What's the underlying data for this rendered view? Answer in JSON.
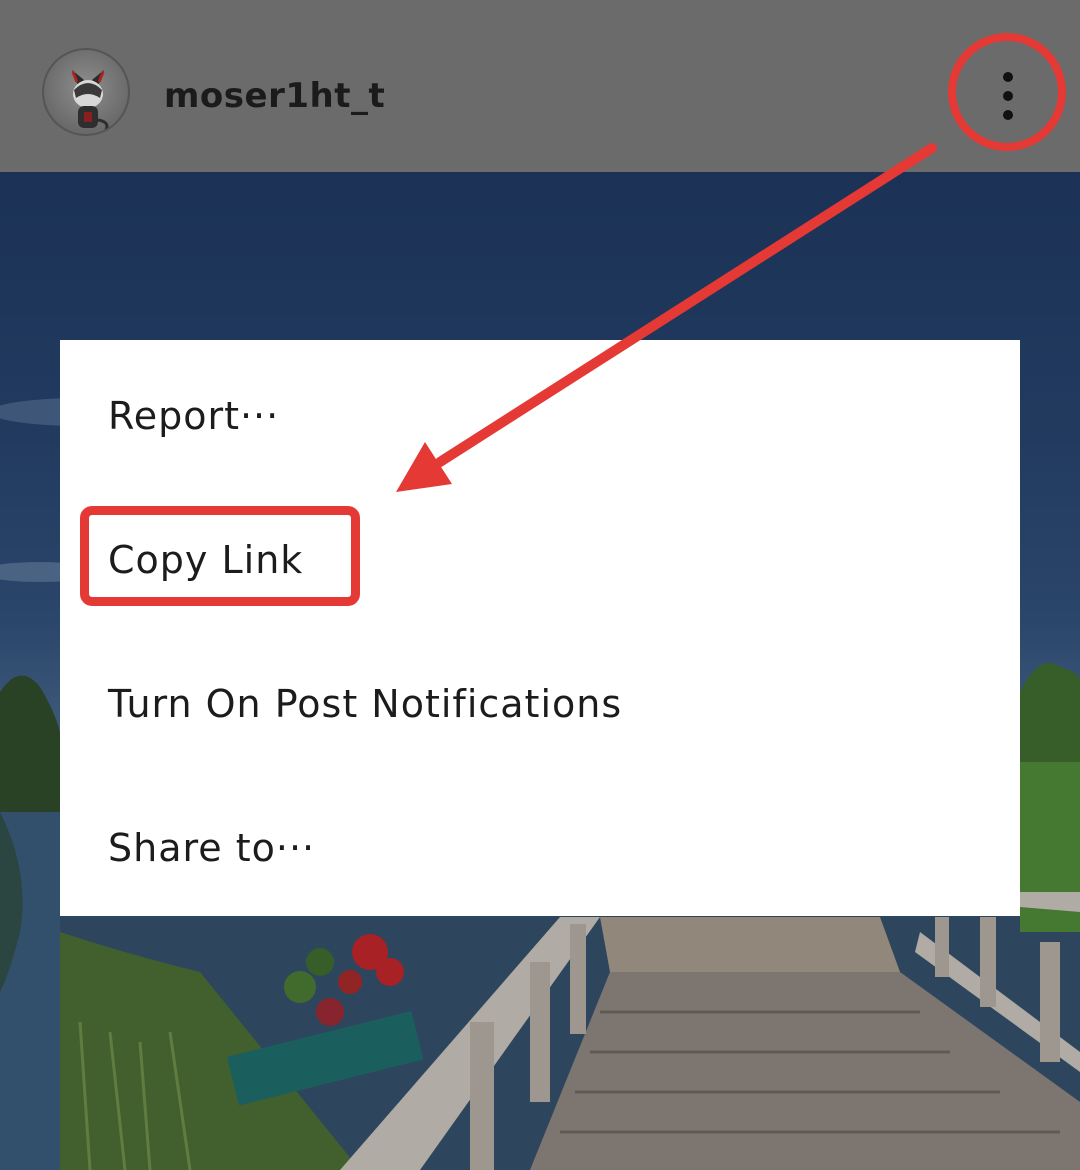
{
  "header": {
    "username": "moser1ht_t",
    "avatar_icon": "avatar-character-icon",
    "more_icon": "more-vertical-icon"
  },
  "menu": {
    "items": [
      {
        "label": "Report···"
      },
      {
        "label": "Copy Link"
      },
      {
        "label": "Turn On Post Notifications"
      },
      {
        "label": "Share to···"
      }
    ]
  },
  "annotations": {
    "color": "#e53935"
  }
}
